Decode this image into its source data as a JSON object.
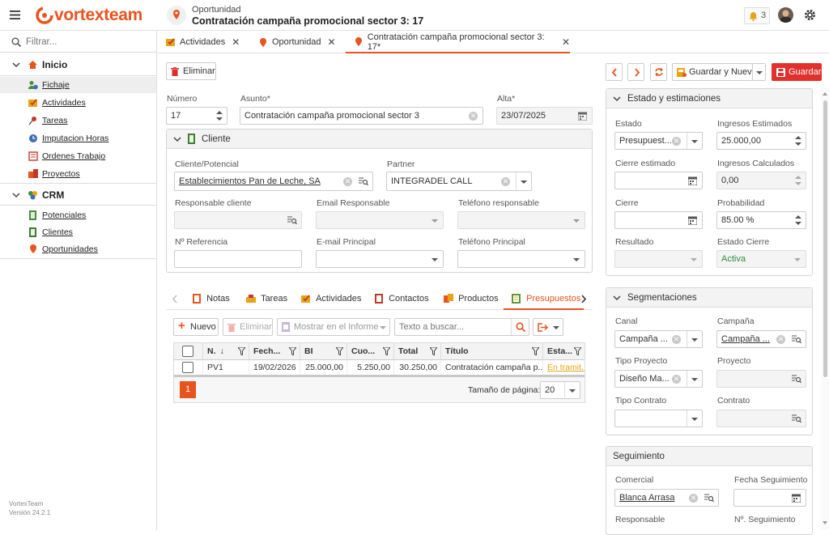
{
  "app": {
    "brand": "vortexteam",
    "crumb_type": "Oportunidad",
    "crumb_title": "Contratación campaña promocional sector 3: 17",
    "notif_count": "3"
  },
  "sidebar": {
    "filter_placeholder": "Filtrar...",
    "group1": "Inicio",
    "g1_items": [
      "Fichaje",
      "Actividades",
      "Tareas",
      "Imputacion Horas",
      "Ordenes Trabajo",
      "Proyectos"
    ],
    "group2": "CRM",
    "g2_items": [
      "Potenciales",
      "Clientes",
      "Oportunidades"
    ],
    "footer_name": "VortexTeam",
    "footer_version": "Versión 24.2.1"
  },
  "tabs": [
    "Actividades",
    "Oportunidad",
    "Contratación campaña promocional sector 3: 17*"
  ],
  "toolbar": {
    "delete": "Eliminar",
    "save_new": "Guardar y Nuevo",
    "save": "Guardar"
  },
  "form": {
    "numero_label": "Número",
    "numero": "17",
    "asunto_label": "Asunto*",
    "asunto": "Contratación campaña promocional sector 3",
    "alta_label": "Alta*",
    "alta": "23/07/2025"
  },
  "cliente": {
    "title": "Cliente",
    "cp_label": "Cliente/Potencial",
    "cp": "Establecimientos Pan de Leche, SA",
    "partner_label": "Partner",
    "partner": "INTEGRADEL CALL",
    "resp_label": "Responsable cliente",
    "email_resp_label": "Email Responsable",
    "tel_resp_label": "Teléfono responsable",
    "ref_label": "Nº Referencia",
    "email_pr_label": "E-mail Principal",
    "tel_pr_label": "Teléfono Principal"
  },
  "subtabs": [
    "Notas",
    "Tareas",
    "Actividades",
    "Contactos",
    "Productos",
    "Presupuestos"
  ],
  "grid": {
    "new": "Nuevo",
    "delete": "Eliminar",
    "report": "Mostrar en el Informe",
    "search_placeholder": "Texto a buscar...",
    "cols": [
      "N.",
      "Fech...",
      "BI",
      "Cuo...",
      "Total",
      "Título",
      "Esta..."
    ],
    "rows": [
      [
        "PV1",
        "19/02/2026",
        "25.000,00",
        "5.250,00",
        "30.250,00",
        "Contratación campaña p...",
        "En tramit..."
      ]
    ],
    "page": "1",
    "page_size_label": "Tamaño de página:",
    "page_size": "20"
  },
  "estado": {
    "title": "Estado y estimaciones",
    "estado_label": "Estado",
    "estado": "Presupuest...",
    "ingresos_est_label": "Ingresos Estimados",
    "ingresos_est": "25.000,00",
    "cierre_est_label": "Cierre estimado",
    "ingresos_calc_label": "Ingresos Calculados",
    "ingresos_calc": "0,00",
    "cierre_label": "Cierre",
    "prob_label": "Probabilidad",
    "prob": "85.00 %",
    "resultado_label": "Resultado",
    "estado_cierre_label": "Estado Cierre",
    "estado_cierre": "Activa"
  },
  "segm": {
    "title": "Segmentaciones",
    "canal_label": "Canal",
    "canal": "Campaña ...",
    "campana_label": "Campaña",
    "campana": "Campaña ...",
    "tipo_proy_label": "Tipo Proyecto",
    "tipo_proy": "Diseño Ma...",
    "proyecto_label": "Proyecto",
    "tipo_contrato_label": "Tipo Contrato",
    "contrato_label": "Contrato"
  },
  "seguim": {
    "title": "Seguimiento",
    "comercial_label": "Comercial",
    "comercial": "Blanca Arrasa",
    "fecha_label": "Fecha Seguimiento",
    "resp_label": "Responsable",
    "num_label": "Nº. Seguimiento"
  },
  "colors": {
    "accent": "#e8541d",
    "save": "#e0312c",
    "link": "#e8a317"
  }
}
